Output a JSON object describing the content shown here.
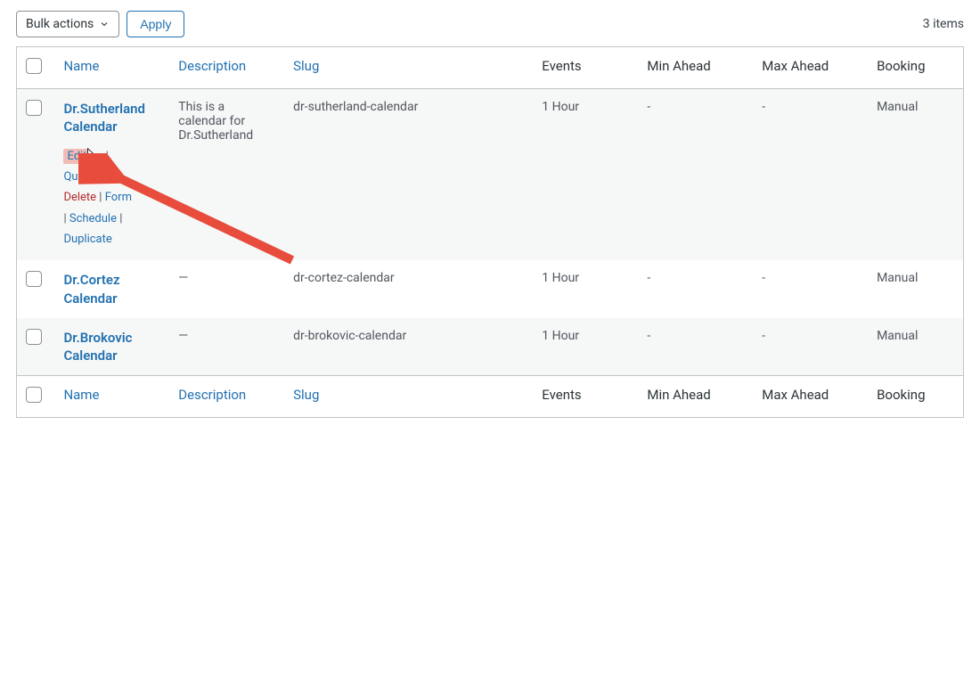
{
  "toolbar": {
    "bulk_actions_label": "Bulk actions",
    "apply_label": "Apply",
    "items_count": "3 items"
  },
  "columns": {
    "name": "Name",
    "description": "Description",
    "slug": "Slug",
    "events": "Events",
    "min_ahead": "Min Ahead",
    "max_ahead": "Max Ahead",
    "booking": "Booking"
  },
  "rows": [
    {
      "title": "Dr.Sutherland Calendar",
      "description": "This is a calendar for Dr.Sutherland",
      "slug": "dr-sutherland-calendar",
      "events": "1 Hour",
      "min_ahead": "-",
      "max_ahead": "-",
      "booking": "Manual",
      "actions": {
        "edit": "Edit",
        "quick_edit": "Quick Edit",
        "delete": "Delete",
        "form": "Form",
        "schedule": "Schedule",
        "duplicate": "Duplicate"
      }
    },
    {
      "title": "Dr.Cortez Calendar",
      "description": "—",
      "slug": "dr-cortez-calendar",
      "events": "1 Hour",
      "min_ahead": "-",
      "max_ahead": "-",
      "booking": "Manual"
    },
    {
      "title": "Dr.Brokovic Calendar",
      "description": "—",
      "slug": "dr-brokovic-calendar",
      "events": "1 Hour",
      "min_ahead": "-",
      "max_ahead": "-",
      "booking": "Manual"
    }
  ]
}
